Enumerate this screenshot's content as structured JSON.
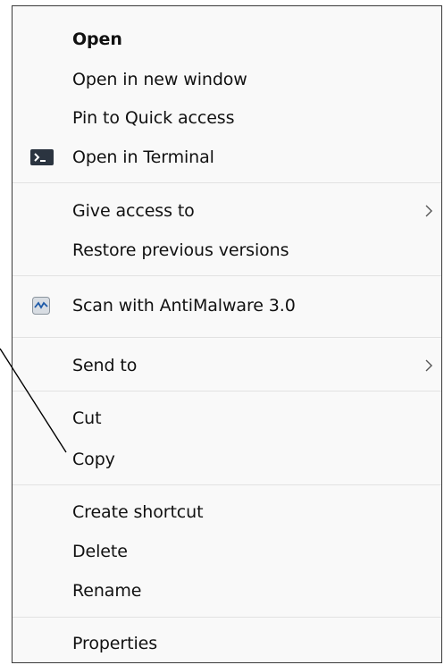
{
  "context_menu": {
    "items": [
      {
        "label": "Open",
        "bold": true
      },
      {
        "label": "Open in new window"
      },
      {
        "label": "Pin to Quick access"
      },
      {
        "label": "Open in Terminal",
        "icon": "terminal-icon"
      },
      {
        "label": "Give access to",
        "submenu": true
      },
      {
        "label": "Restore previous versions"
      },
      {
        "label": "Scan with AntiMalware 3.0",
        "icon": "antimalware-icon"
      },
      {
        "label": "Send to",
        "submenu": true
      },
      {
        "label": "Cut"
      },
      {
        "label": "Copy"
      },
      {
        "label": "Create shortcut"
      },
      {
        "label": "Delete"
      },
      {
        "label": "Rename"
      },
      {
        "label": "Properties"
      }
    ]
  },
  "colors": {
    "menu_background": "#f9f9f9",
    "separator": "#e2e2e2",
    "text": "#111111",
    "border": "#3a3a3a"
  }
}
